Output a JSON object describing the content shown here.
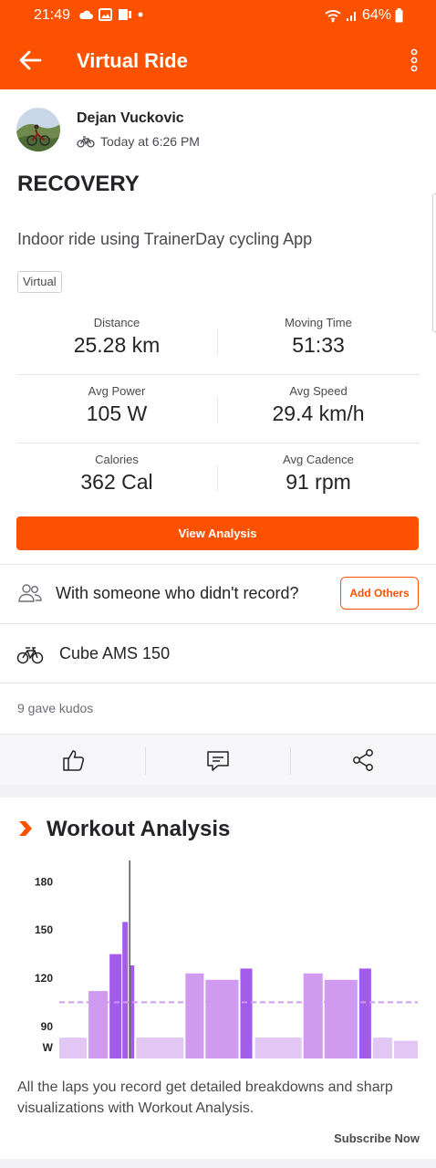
{
  "status_bar": {
    "time": "21:49",
    "battery": "64%"
  },
  "app_bar": {
    "title": "Virtual Ride"
  },
  "athlete": {
    "name": "Dejan Vuckovic",
    "timestamp": "Today at 6:26 PM"
  },
  "activity": {
    "title": "RECOVERY",
    "description": "Indoor ride using TrainerDay cycling App",
    "tag": "Virtual"
  },
  "stats": [
    {
      "left": {
        "label": "Distance",
        "value": "25.28 km"
      },
      "right": {
        "label": "Moving Time",
        "value": "51:33"
      }
    },
    {
      "left": {
        "label": "Avg Power",
        "value": "105 W"
      },
      "right": {
        "label": "Avg Speed",
        "value": "29.4 km/h"
      }
    },
    {
      "left": {
        "label": "Calories",
        "value": "362 Cal"
      },
      "right": {
        "label": "Avg Cadence",
        "value": "91 rpm"
      }
    }
  ],
  "buttons": {
    "view_analysis": "View Analysis",
    "add_others": "Add Others",
    "subscribe": "Subscribe Now"
  },
  "with_others": {
    "text": "With someone who didn't record?"
  },
  "gear": {
    "name": "Cube AMS 150"
  },
  "kudos": {
    "text": "9 gave kudos"
  },
  "workout_analysis": {
    "title": "Workout Analysis",
    "description": "All the laps you record get detailed breakdowns and sharp visualizations with Workout Analysis."
  },
  "colors": {
    "brand": "#fc5200",
    "bar_light": "#e2c7f5",
    "bar_mid": "#cf9af0",
    "bar_dark": "#a35bea"
  },
  "chart_data": {
    "type": "bar",
    "ylabel": "W",
    "yticks": [
      90,
      120,
      150,
      180
    ],
    "ylim": [
      70,
      195
    ],
    "reference_line": 105,
    "bars": [
      {
        "x0": 0,
        "x1": 30,
        "value": 83,
        "shade": "light"
      },
      {
        "x0": 32,
        "x1": 53,
        "value": 112,
        "shade": "mid"
      },
      {
        "x0": 55,
        "x1": 68,
        "value": 135,
        "shade": "dark"
      },
      {
        "x0": 69,
        "x1": 75,
        "value": 155,
        "shade": "dark"
      },
      {
        "x0": 77,
        "x1": 82,
        "value": 128,
        "shade": "dark"
      },
      {
        "x0": 84,
        "x1": 136,
        "value": 83,
        "shade": "light"
      },
      {
        "x0": 138,
        "x1": 158,
        "value": 123,
        "shade": "mid"
      },
      {
        "x0": 160,
        "x1": 196,
        "value": 119,
        "shade": "mid"
      },
      {
        "x0": 198,
        "x1": 211,
        "value": 126,
        "shade": "dark"
      },
      {
        "x0": 214,
        "x1": 265,
        "value": 83,
        "shade": "light"
      },
      {
        "x0": 267,
        "x1": 288,
        "value": 123,
        "shade": "mid"
      },
      {
        "x0": 290,
        "x1": 326,
        "value": 119,
        "shade": "mid"
      },
      {
        "x0": 328,
        "x1": 341,
        "value": 126,
        "shade": "dark"
      },
      {
        "x0": 343,
        "x1": 364,
        "value": 83,
        "shade": "light"
      },
      {
        "x0": 366,
        "x1": 392,
        "value": 81,
        "shade": "light"
      }
    ],
    "cursor_x": 77
  }
}
